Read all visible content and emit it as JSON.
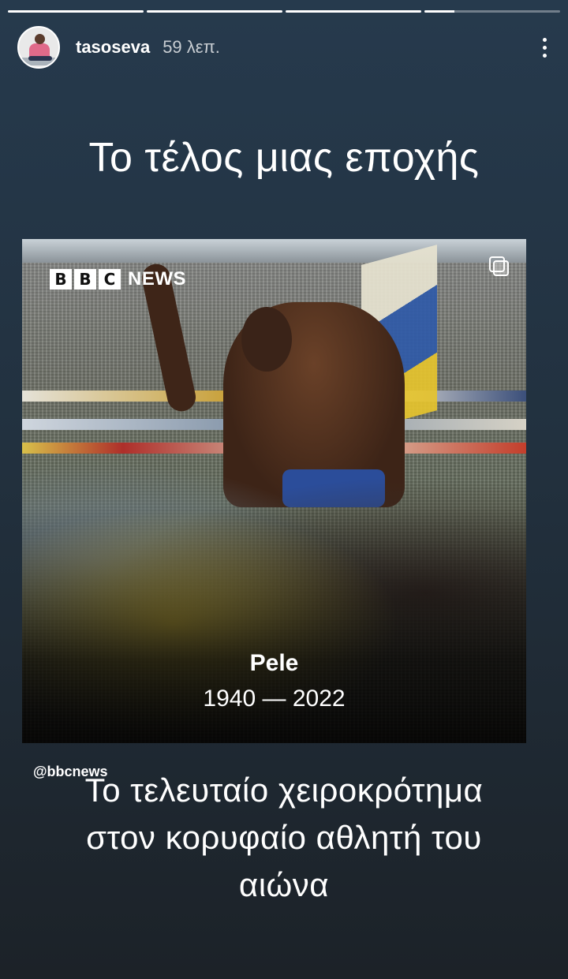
{
  "story": {
    "progress": [
      1,
      1,
      1,
      0.22
    ]
  },
  "header": {
    "username": "tasoseva",
    "time": "59 λεπ."
  },
  "title": "Το τέλος μιας εποχής",
  "post": {
    "brand_letters": [
      "B",
      "B",
      "C"
    ],
    "brand_word": "NEWS",
    "caption_name": "Pele",
    "caption_years": "1940 — 2022"
  },
  "attribution": "@bbcnews",
  "bottom_text": "Το τελευταίο χειροκρότημα στον κορυφαίο αθλητή του αιώνα"
}
